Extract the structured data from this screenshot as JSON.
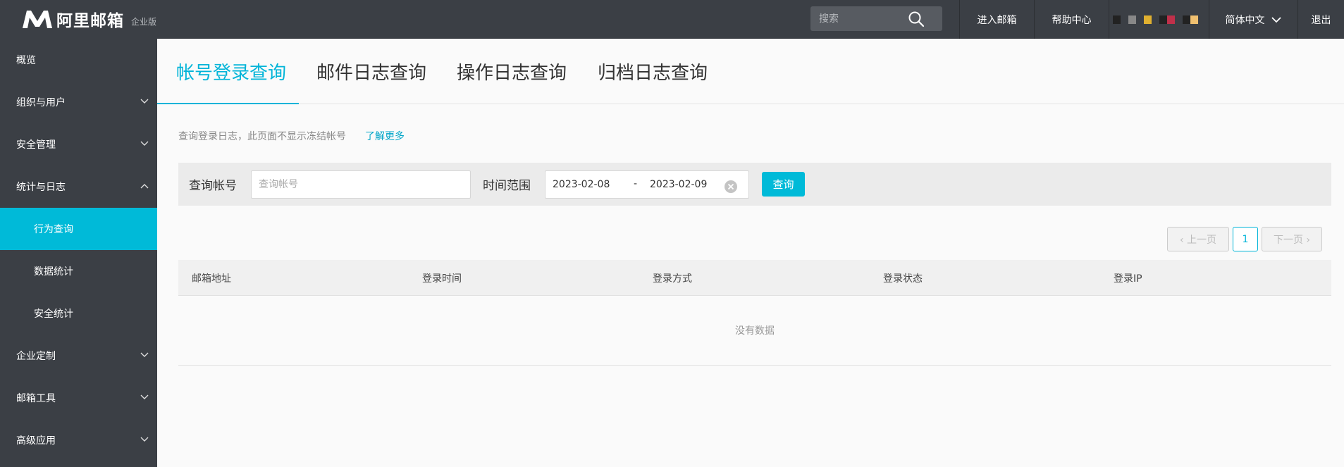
{
  "header": {
    "logo_text": "阿里邮箱",
    "edition": "企业版",
    "search": {
      "placeholder": "搜索",
      "value": ""
    },
    "nav": {
      "enter_mail": "进入邮箱",
      "help": "帮助中心",
      "language": "简体中文",
      "logout": "退出"
    },
    "user_redacted_colors": [
      "#222222",
      "#3b3f45",
      "#888888",
      "#3b3f45",
      "#e0b030",
      "#3b3f45",
      "#222222",
      "#c0304a",
      "#3b3f45",
      "#222222",
      "#f0c070",
      "#3b3f45"
    ]
  },
  "sidebar": {
    "items": [
      {
        "label": "概览"
      },
      {
        "label": "组织与用户"
      },
      {
        "label": "安全管理"
      },
      {
        "label": "统计与日志"
      },
      {
        "label": "行为查询"
      },
      {
        "label": "数据统计"
      },
      {
        "label": "安全统计"
      },
      {
        "label": "企业定制"
      },
      {
        "label": "邮箱工具"
      },
      {
        "label": "高级应用"
      }
    ]
  },
  "tabs": [
    {
      "label": "帐号登录查询"
    },
    {
      "label": "邮件日志查询"
    },
    {
      "label": "操作日志查询"
    },
    {
      "label": "归档日志查询"
    }
  ],
  "hint": {
    "text": "查询登录日志，此页面不显示冻结帐号",
    "link": "了解更多"
  },
  "filter": {
    "account_label": "查询帐号",
    "account_placeholder": "查询帐号",
    "account_value": "",
    "range_label": "时间范围",
    "start_date": "2023-02-08",
    "separator": "-",
    "end_date": "2023-02-09",
    "query_button": "查询"
  },
  "pagination": {
    "prev": "‹ 上一页",
    "current": "1",
    "next": "下一页 ›"
  },
  "table": {
    "columns": [
      "邮箱地址",
      "登录时间",
      "登录方式",
      "登录状态",
      "登录IP"
    ],
    "empty_text": "没有数据"
  },
  "colors": {
    "accent": "#00bad8",
    "sidebar_bg": "#3b3f45"
  }
}
